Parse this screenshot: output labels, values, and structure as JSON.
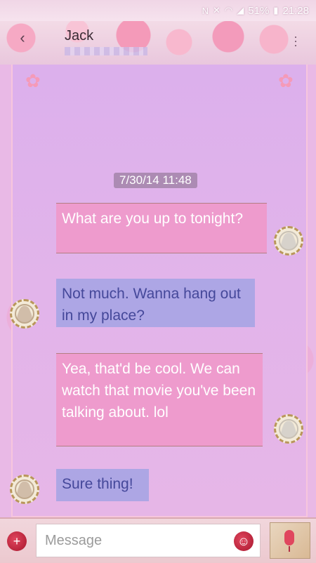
{
  "status_bar": {
    "icons": [
      "nfc-icon",
      "mute-icon",
      "wifi-icon",
      "signal-icon"
    ],
    "battery": "51%",
    "time": "21:28"
  },
  "header": {
    "contact_name": "Jack"
  },
  "conversation": {
    "timestamp": "7/30/14 11:48",
    "messages": [
      {
        "type": "sent",
        "text": "What are you up to tonight?"
      },
      {
        "type": "received",
        "text": "Not much. Wanna hang out in my place?"
      },
      {
        "type": "sent",
        "text": "Yea, that'd be cool. We can watch that movie you've been talking about. lol"
      },
      {
        "type": "received",
        "text": "Sure thing!"
      }
    ]
  },
  "compose": {
    "placeholder": "Message"
  },
  "colors": {
    "sent_bubble": "#f096c8",
    "received_bubble": "#a8a5e4",
    "accent_seal": "#c81e3a"
  }
}
